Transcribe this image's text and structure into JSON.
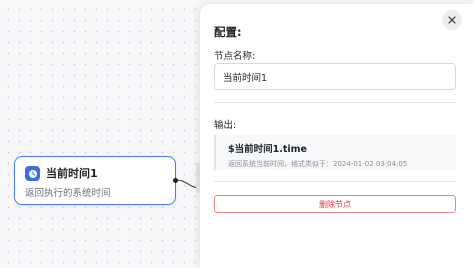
{
  "node": {
    "icon": "clock-icon",
    "title": "当前时间1",
    "description": "返回执行的系统时间"
  },
  "panel": {
    "title": "配置:",
    "name_label": "节点名称:",
    "name_value": "当前时间1",
    "output_label": "输出:",
    "output": {
      "variable": "$当前时间1.time",
      "description": "返回系统当前时间，格式类似于：2024-01-02 03:04:05"
    },
    "delete_label": "删除节点",
    "close_icon": "close-icon"
  },
  "colors": {
    "accent": "#4b7bec",
    "node_icon_bg": "#3f6fe0",
    "danger": "#d6454f"
  }
}
